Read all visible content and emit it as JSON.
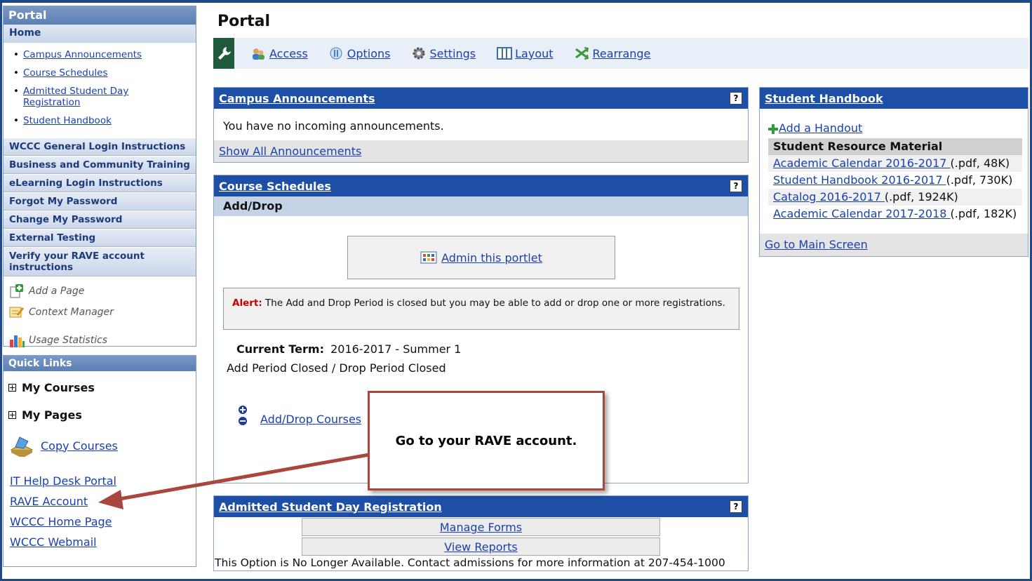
{
  "sidebar": {
    "title": "Portal",
    "home": "Home",
    "home_links": [
      "Campus Announcements",
      "Course Schedules",
      "Admitted Student Day Registration",
      "Student Handbook"
    ],
    "items": [
      "WCCC General Login Instructions",
      "Business and Community Training",
      "eLearning Login Instructions",
      "Forgot My Password",
      "Change My Password",
      "External Testing",
      "Verify your RAVE account instructions"
    ],
    "tools": [
      "Add a Page",
      "Context Manager",
      "Usage Statistics"
    ]
  },
  "quick_links": {
    "title": "Quick Links",
    "my_courses": "My Courses",
    "my_pages": "My Pages",
    "copy_courses": "Copy Courses",
    "links": [
      "IT Help Desk Portal",
      "RAVE Account",
      "WCCC Home Page",
      "WCCC Webmail"
    ]
  },
  "page": {
    "title": "Portal",
    "toolbar": [
      "Access",
      "Options",
      "Settings",
      "Layout",
      "Rearrange"
    ]
  },
  "announcements": {
    "title": "Campus Announcements",
    "help": "?",
    "message": "You have no incoming announcements.",
    "show_all": "Show All Announcements"
  },
  "schedules": {
    "title": "Course Schedules",
    "help": "?",
    "subhead": "Add/Drop",
    "admin": "Admin this portlet",
    "alert_label": "Alert:",
    "alert_text": " The Add and Drop Period is closed but you may be able to add or drop one or more registrations.",
    "current_term_label": "Current Term:",
    "current_term_value": "2016-2017 - Summer 1",
    "period_status": "Add Period Closed / Drop Period Closed",
    "add_drop_link": "Add/Drop Courses"
  },
  "admitted": {
    "title": "Admitted Student Day Registration",
    "help": "?",
    "manage_forms": "Manage Forms",
    "view_reports": "View Reports",
    "notice": "This Option is No Longer Available. Contact admissions for more information at 207-454-1000"
  },
  "handbook": {
    "title": "Student Handbook",
    "add_handout": "Add a Handout",
    "section": "Student Resource Material",
    "files": [
      {
        "name": "Academic Calendar 2016-2017 ",
        "meta": "(.pdf, 48K)"
      },
      {
        "name": "Student Handbook 2016-2017 ",
        "meta": "(.pdf, 730K)"
      },
      {
        "name": "Catalog 2016-2017 ",
        "meta": "(.pdf, 1924K)"
      },
      {
        "name": "Academic Calendar 2017-2018 ",
        "meta": "(.pdf, 182K)"
      }
    ],
    "main_screen": "Go to Main Screen"
  },
  "callout": {
    "text": "Go to your RAVE account."
  },
  "colors": {
    "portlet_header": "#1d4fa6",
    "callout_border": "#a9473e",
    "link": "#1a3fb0"
  }
}
